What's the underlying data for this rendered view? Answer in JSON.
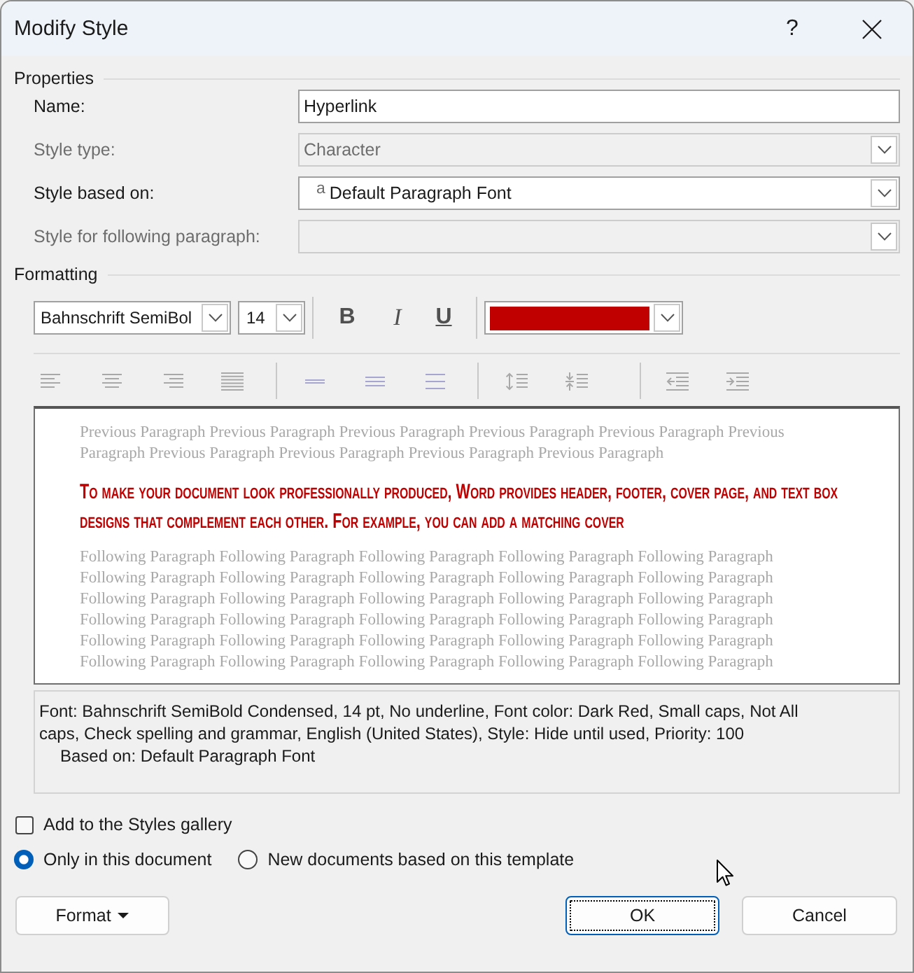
{
  "window": {
    "title": "Modify Style",
    "help_button": "?"
  },
  "properties": {
    "heading": "Properties",
    "fields": [
      {
        "kind": "text",
        "label": "Name:",
        "value": "Hyperlink",
        "disabled": false
      },
      {
        "kind": "dropdown",
        "label": "Style type:",
        "value": "Character",
        "disabled": true
      },
      {
        "kind": "dropdown",
        "label": "Style based on:",
        "marker": "a",
        "value": "Default Paragraph Font",
        "disabled": false
      },
      {
        "kind": "dropdown",
        "label": "Style for following paragraph:",
        "disabled": true
      }
    ]
  },
  "formatting": {
    "heading": "Formatting",
    "font": "Bahnschrift SemiBol",
    "size": "14",
    "toggles": [
      {
        "kind": "bold",
        "label": "B",
        "pressed": false
      },
      {
        "kind": "italic",
        "label": "I",
        "pressed": false
      },
      {
        "kind": "underline",
        "label": "U",
        "pressed": false
      }
    ],
    "font_color": {
      "color": "#c00000"
    },
    "paragraph_tools": {
      "disabled": true
    }
  },
  "preview": {
    "previous_paragraph": "Previous Paragraph Previous Paragraph Previous Paragraph Previous Paragraph Previous Paragraph Previous Paragraph Previous Paragraph Previous Paragraph Previous Paragraph Previous Paragraph",
    "sample_text": "To make your document look professionally produced, Word provides header, footer, cover page, and text box designs that complement each other. For example, you can add a matching cover",
    "following_paragraph": "Following Paragraph Following Paragraph Following Paragraph Following Paragraph Following Paragraph Following Paragraph Following Paragraph Following Paragraph Following Paragraph Following Paragraph Following Paragraph Following Paragraph Following Paragraph Following Paragraph Following Paragraph Following Paragraph Following Paragraph Following Paragraph Following Paragraph Following Paragraph Following Paragraph Following Paragraph Following Paragraph Following Paragraph Following Paragraph Following Paragraph Following Paragraph Following Paragraph Following Paragraph Following Paragraph"
  },
  "description": {
    "text": "Font: Bahnschrift SemiBold Condensed, 14 pt, No underline, Font color: Dark Red, Small caps, Not All caps, Check spelling and grammar, English (United States), Style: Hide until used, Priority: 100",
    "based_on": "Based on: Default Paragraph Font"
  },
  "add_to_gallery": {
    "label": "Add to the Styles gallery",
    "checked": false
  },
  "scope": [
    {
      "label": "Only in this document",
      "selected": true
    },
    {
      "label": "New documents based on this template",
      "selected": false
    }
  ],
  "buttons": [
    {
      "kind": "menu",
      "label": "Format",
      "focused": false
    },
    {
      "kind": "default",
      "label": "OK",
      "focused": true
    },
    {
      "kind": "normal",
      "label": "Cancel",
      "focused": false
    }
  ]
}
